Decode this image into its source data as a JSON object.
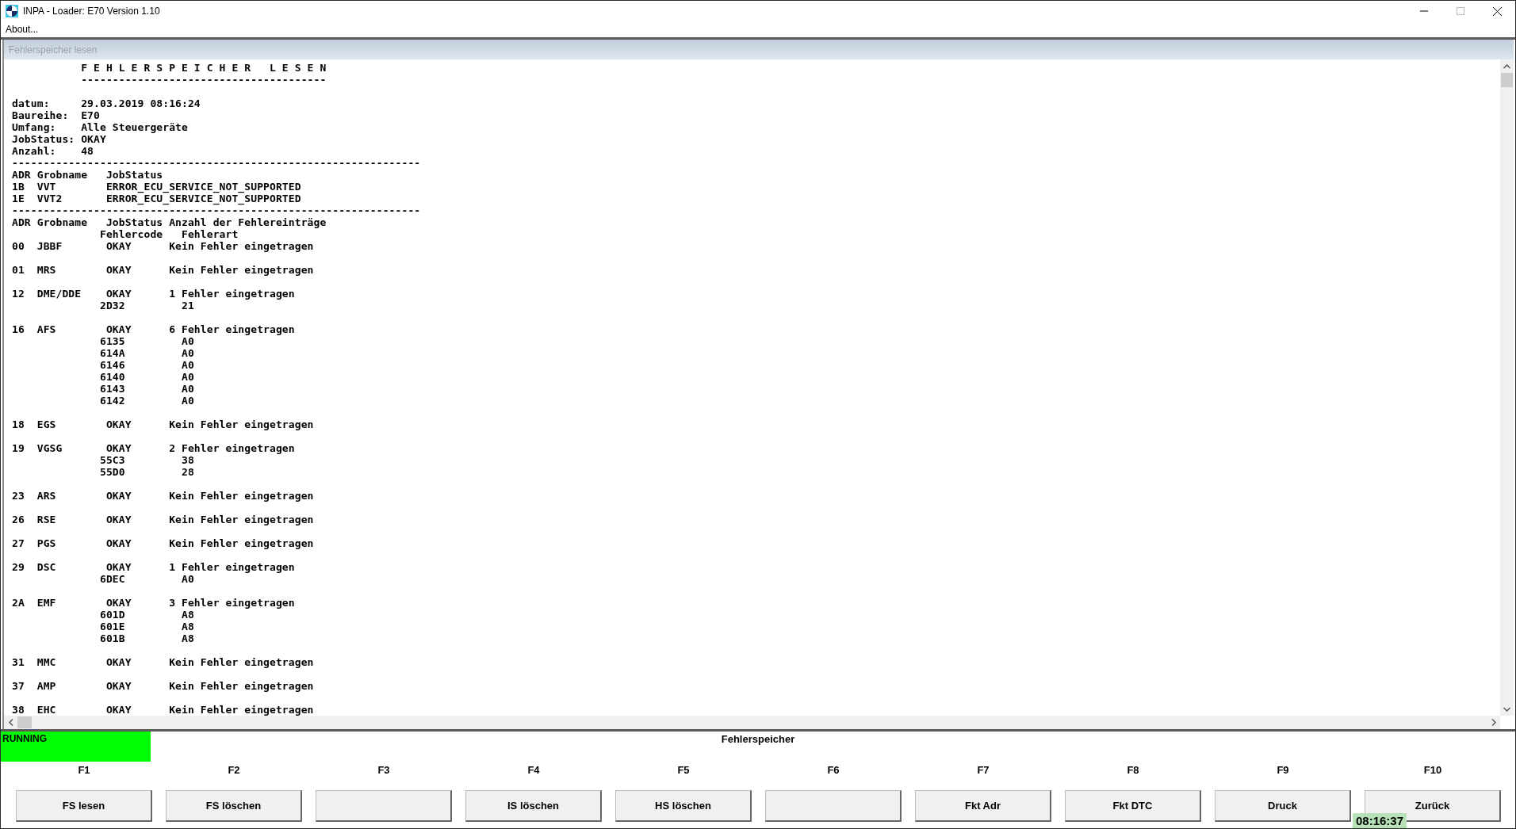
{
  "window": {
    "title": "INPA - Loader:  E70 Version 1.10"
  },
  "menu": [
    "About..."
  ],
  "child_window": {
    "title": "Fehlerspeicher lesen"
  },
  "output_lines": [
    {
      "kind": "text",
      "text": "           F E H L E R S P E I C H E R   L E S E N"
    },
    {
      "kind": "text",
      "text": "           ---------------------------------------"
    },
    {
      "kind": "blank"
    },
    {
      "kind": "text",
      "text": "datum:     29.03.2019 08:16:24"
    },
    {
      "kind": "text",
      "text": "Baureihe:  E70"
    },
    {
      "kind": "text",
      "text": "Umfang:    Alle Steuergeräte"
    },
    {
      "kind": "text",
      "text": "JobStatus: OKAY"
    },
    {
      "kind": "text",
      "text": "Anzahl:    48"
    },
    {
      "kind": "text",
      "text": "-----------------------------------------------------------------"
    },
    {
      "kind": "text",
      "text": "ADR Grobname   JobStatus"
    },
    {
      "kind": "text",
      "text": "1B  VVT        ERROR_ECU_SERVICE_NOT_SUPPORTED"
    },
    {
      "kind": "text",
      "text": "1E  VVT2       ERROR_ECU_SERVICE_NOT_SUPPORTED"
    },
    {
      "kind": "text",
      "text": "-----------------------------------------------------------------"
    },
    {
      "kind": "text",
      "text": "ADR Grobname   JobStatus Anzahl der Fehlereinträge"
    },
    {
      "kind": "text",
      "text": "              Fehlercode   Fehlerart"
    },
    {
      "kind": "text",
      "text": "00  JBBF       OKAY      Kein Fehler eingetragen"
    },
    {
      "kind": "blank"
    },
    {
      "kind": "text",
      "text": "01  MRS        OKAY      Kein Fehler eingetragen"
    },
    {
      "kind": "blank"
    },
    {
      "kind": "text",
      "text": "12  DME/DDE    OKAY      1 Fehler eingetragen"
    },
    {
      "kind": "text",
      "text": "              2D32         21"
    },
    {
      "kind": "blank"
    },
    {
      "kind": "text",
      "text": "16  AFS        OKAY      6 Fehler eingetragen"
    },
    {
      "kind": "text",
      "text": "              6135         A0"
    },
    {
      "kind": "text",
      "text": "              614A         A0"
    },
    {
      "kind": "text",
      "text": "              6146         A0"
    },
    {
      "kind": "text",
      "text": "              6140         A0"
    },
    {
      "kind": "text",
      "text": "              6143         A0"
    },
    {
      "kind": "text",
      "text": "              6142         A0"
    },
    {
      "kind": "blank"
    },
    {
      "kind": "text",
      "text": "18  EGS        OKAY      Kein Fehler eingetragen"
    },
    {
      "kind": "blank"
    },
    {
      "kind": "text",
      "text": "19  VGSG       OKAY      2 Fehler eingetragen"
    },
    {
      "kind": "text",
      "text": "              55C3         38"
    },
    {
      "kind": "text",
      "text": "              55D0         28"
    },
    {
      "kind": "blank"
    },
    {
      "kind": "text",
      "text": "23  ARS        OKAY      Kein Fehler eingetragen"
    },
    {
      "kind": "blank"
    },
    {
      "kind": "text",
      "text": "26  RSE        OKAY      Kein Fehler eingetragen"
    },
    {
      "kind": "blank"
    },
    {
      "kind": "text",
      "text": "27  PGS        OKAY      Kein Fehler eingetragen"
    },
    {
      "kind": "blank"
    },
    {
      "kind": "text",
      "text": "29  DSC        OKAY      1 Fehler eingetragen"
    },
    {
      "kind": "text",
      "text": "              6DEC         A0"
    },
    {
      "kind": "blank"
    },
    {
      "kind": "text",
      "text": "2A  EMF        OKAY      3 Fehler eingetragen"
    },
    {
      "kind": "text",
      "text": "              601D         A8"
    },
    {
      "kind": "text",
      "text": "              601E         A8"
    },
    {
      "kind": "text",
      "text": "              601B         A8"
    },
    {
      "kind": "blank"
    },
    {
      "kind": "text",
      "text": "31  MMC        OKAY      Kein Fehler eingetragen"
    },
    {
      "kind": "blank"
    },
    {
      "kind": "text",
      "text": "37  AMP        OKAY      Kein Fehler eingetragen"
    },
    {
      "kind": "blank"
    },
    {
      "kind": "text",
      "text": "38  EHC        OKAY      Kein Fehler eingetragen"
    }
  ],
  "status": {
    "label": "RUNNING"
  },
  "section_title": "Fehlerspeicher",
  "function_keys": [
    {
      "key": "F1",
      "label": "FS lesen"
    },
    {
      "key": "F2",
      "label": "FS löschen"
    },
    {
      "key": "F3"
    },
    {
      "key": "F4",
      "label": "IS löschen"
    },
    {
      "key": "F5",
      "label": "HS löschen"
    },
    {
      "key": "F6"
    },
    {
      "key": "F7",
      "label": "Fkt Adr"
    },
    {
      "key": "F8",
      "label": "Fkt DTC"
    },
    {
      "key": "F9",
      "label": "Druck"
    },
    {
      "key": "F10",
      "label": "Zurück"
    }
  ],
  "clock": "08:16:37"
}
